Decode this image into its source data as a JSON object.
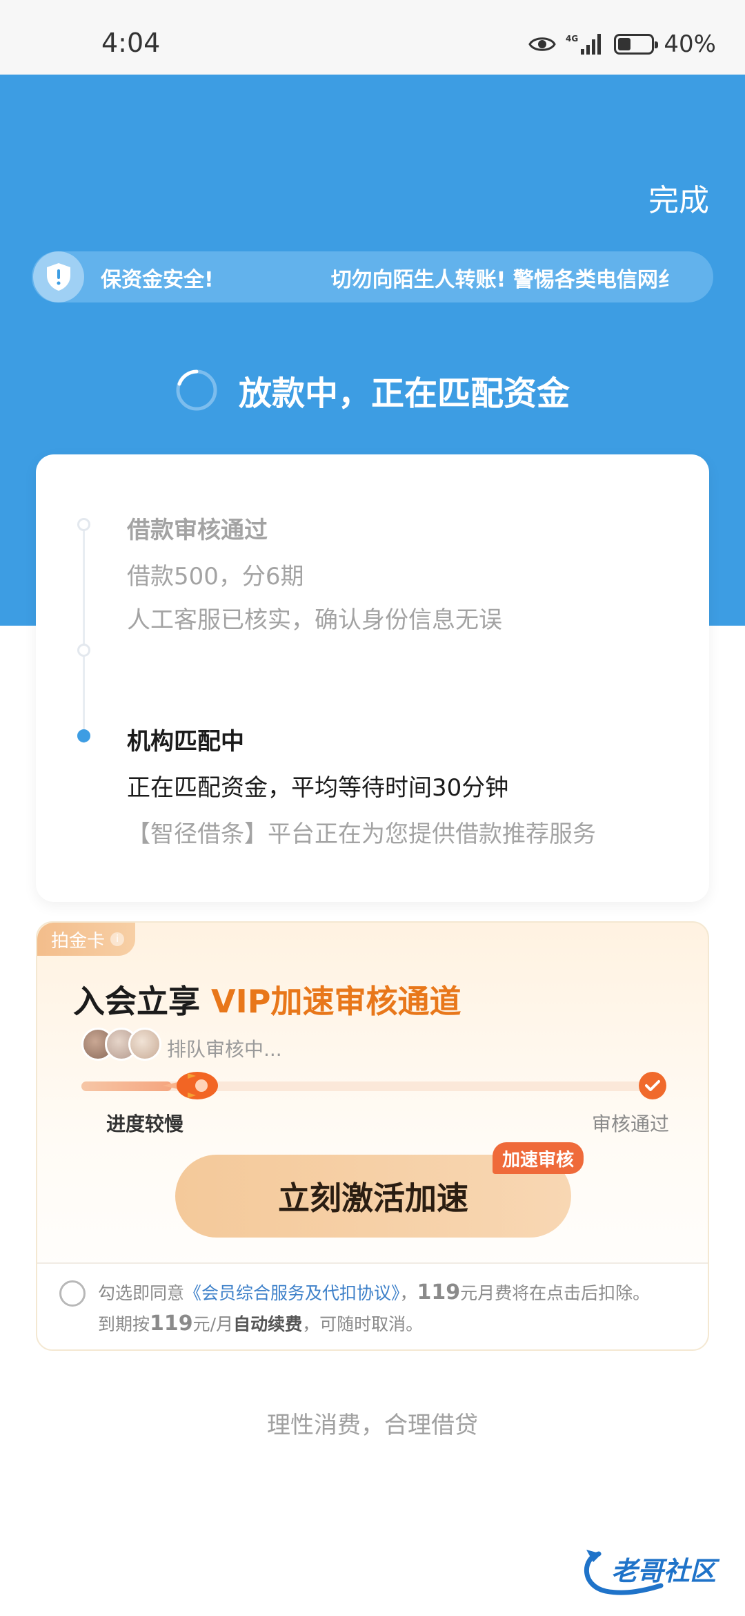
{
  "status_bar": {
    "time": "4:04",
    "network": "4G",
    "battery": "40%",
    "battery_level": 0.4
  },
  "header": {
    "done_label": "完成",
    "notice": {
      "text_1": "保资金安全!",
      "text_2": "切勿向陌生人转账! 警惕各类电信网纟"
    },
    "loading_text": "放款中，正在匹配资金"
  },
  "progress": {
    "steps": [
      {
        "title": "借款审核通过",
        "desc": "借款500，分6期"
      },
      {
        "title": "",
        "desc": "人工客服已核实，确认身份信息无误"
      },
      {
        "title": "机构匹配中",
        "desc": "正在匹配资金，平均等待时间30分钟",
        "desc2": "【智径借条】平台正在为您提供借款推荐服务"
      }
    ]
  },
  "vip": {
    "tag": "拍金卡",
    "headline_prefix": "入会立享 ",
    "headline_highlight": "VIP加速审核通道",
    "queue_text": "排队审核中...",
    "progress_fraction": 0.16,
    "label_slow": "进度较慢",
    "label_pass": "审核通过",
    "badge": "加速审核",
    "button": "立刻激活加速",
    "agreement": {
      "prefix": "勾选即同意",
      "link": "《会员综合服务及代扣协议》",
      "sep": "，",
      "amount_1": "119",
      "mid_1": "元月费将在点击后扣除。",
      "mid_2": "到期按",
      "amount_2": "119",
      "mid_3": "元/月",
      "auto": "自动续费",
      "suffix": "，可随时取消。"
    }
  },
  "footer": "理性消费，合理借贷",
  "watermark": "老哥社区",
  "colors": {
    "primary_blue": "#3d9de3",
    "accent_orange": "#e8771a",
    "badge_orange": "#ef6a3a"
  }
}
